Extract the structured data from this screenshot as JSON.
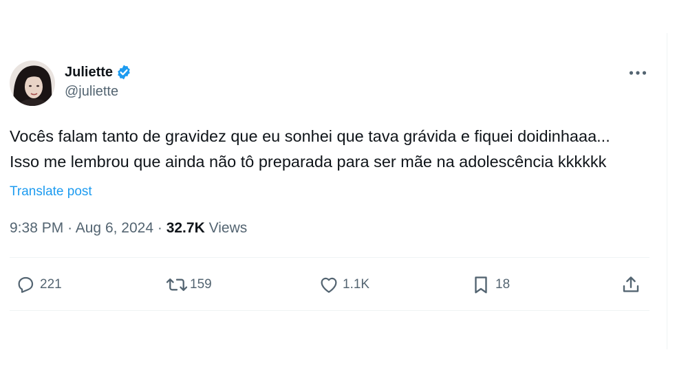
{
  "tweet": {
    "display_name": "Juliette",
    "handle": "@juliette",
    "verified_icon": "verified-badge-icon",
    "body": "Vocês falam tanto de gravidez que eu sonhei que tava grávida e fiquei doidinhaaa... Isso me lembrou que ainda não tô preparada para ser mãe na adolescência kkkkkk",
    "translate_label": "Translate post",
    "time": "9:38 PM",
    "separator": "·",
    "date": "Aug 6, 2024",
    "views_count": "32.7K",
    "views_label": "Views"
  },
  "actions": {
    "replies": "221",
    "reposts": "159",
    "likes": "1.1K",
    "bookmarks": "18"
  },
  "colors": {
    "accent": "#1d9bf0",
    "secondary_text": "#536471",
    "primary_text": "#0f1419",
    "divider": "#eff3f4"
  }
}
